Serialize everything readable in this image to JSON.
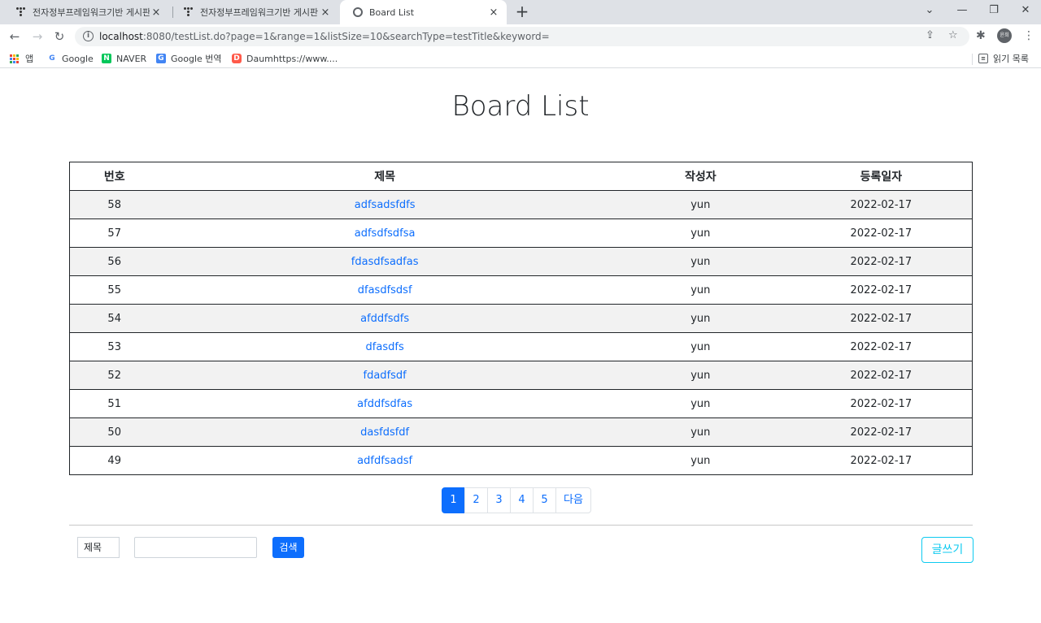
{
  "browser": {
    "tabs": [
      {
        "title": "전자정부프레임워크기반 게시판",
        "close": "×"
      },
      {
        "title": "전자정부프레임워크기반 게시판",
        "close": "×"
      },
      {
        "title": "Board List",
        "close": "×"
      }
    ],
    "new_tab": "+",
    "window_buttons": {
      "dropdown": "⌄",
      "minimize": "—",
      "restore": "❐",
      "close": "✕"
    },
    "url_host": "localhost",
    "url_rest": ":8080/testList.do?page=1&range=1&listSize=10&searchType=testTitle&keyword=",
    "profile": "윤희",
    "bookmarks": {
      "apps": "앱",
      "items": [
        "Google",
        "NAVER",
        "Google 번역",
        "Daumhttps://www...."
      ],
      "reading_list": "읽기 목록"
    }
  },
  "page": {
    "title": "Board List",
    "table": {
      "headers": [
        "번호",
        "제목",
        "작성자",
        "등록일자"
      ],
      "rows": [
        {
          "no": "58",
          "title": "adfsadsfdfs",
          "writer": "yun",
          "date": "2022-02-17"
        },
        {
          "no": "57",
          "title": "adfsdfsdfsa",
          "writer": "yun",
          "date": "2022-02-17"
        },
        {
          "no": "56",
          "title": "fdasdfsadfas",
          "writer": "yun",
          "date": "2022-02-17"
        },
        {
          "no": "55",
          "title": "dfasdfsdsf",
          "writer": "yun",
          "date": "2022-02-17"
        },
        {
          "no": "54",
          "title": "afddfsdfs",
          "writer": "yun",
          "date": "2022-02-17"
        },
        {
          "no": "53",
          "title": "dfasdfs",
          "writer": "yun",
          "date": "2022-02-17"
        },
        {
          "no": "52",
          "title": "fdadfsdf",
          "writer": "yun",
          "date": "2022-02-17"
        },
        {
          "no": "51",
          "title": "afddfsdfas",
          "writer": "yun",
          "date": "2022-02-17"
        },
        {
          "no": "50",
          "title": "dasfdsfdf",
          "writer": "yun",
          "date": "2022-02-17"
        },
        {
          "no": "49",
          "title": "adfdfsadsf",
          "writer": "yun",
          "date": "2022-02-17"
        }
      ]
    },
    "pagination": {
      "pages": [
        "1",
        "2",
        "3",
        "4",
        "5"
      ],
      "active": "1",
      "next": "다음"
    },
    "search": {
      "type_selected": "제목",
      "keyword": "",
      "button": "검색"
    },
    "write_button": "글쓰기",
    "colors": {
      "primary": "#0d6efd",
      "info": "#0dcaf0"
    }
  }
}
